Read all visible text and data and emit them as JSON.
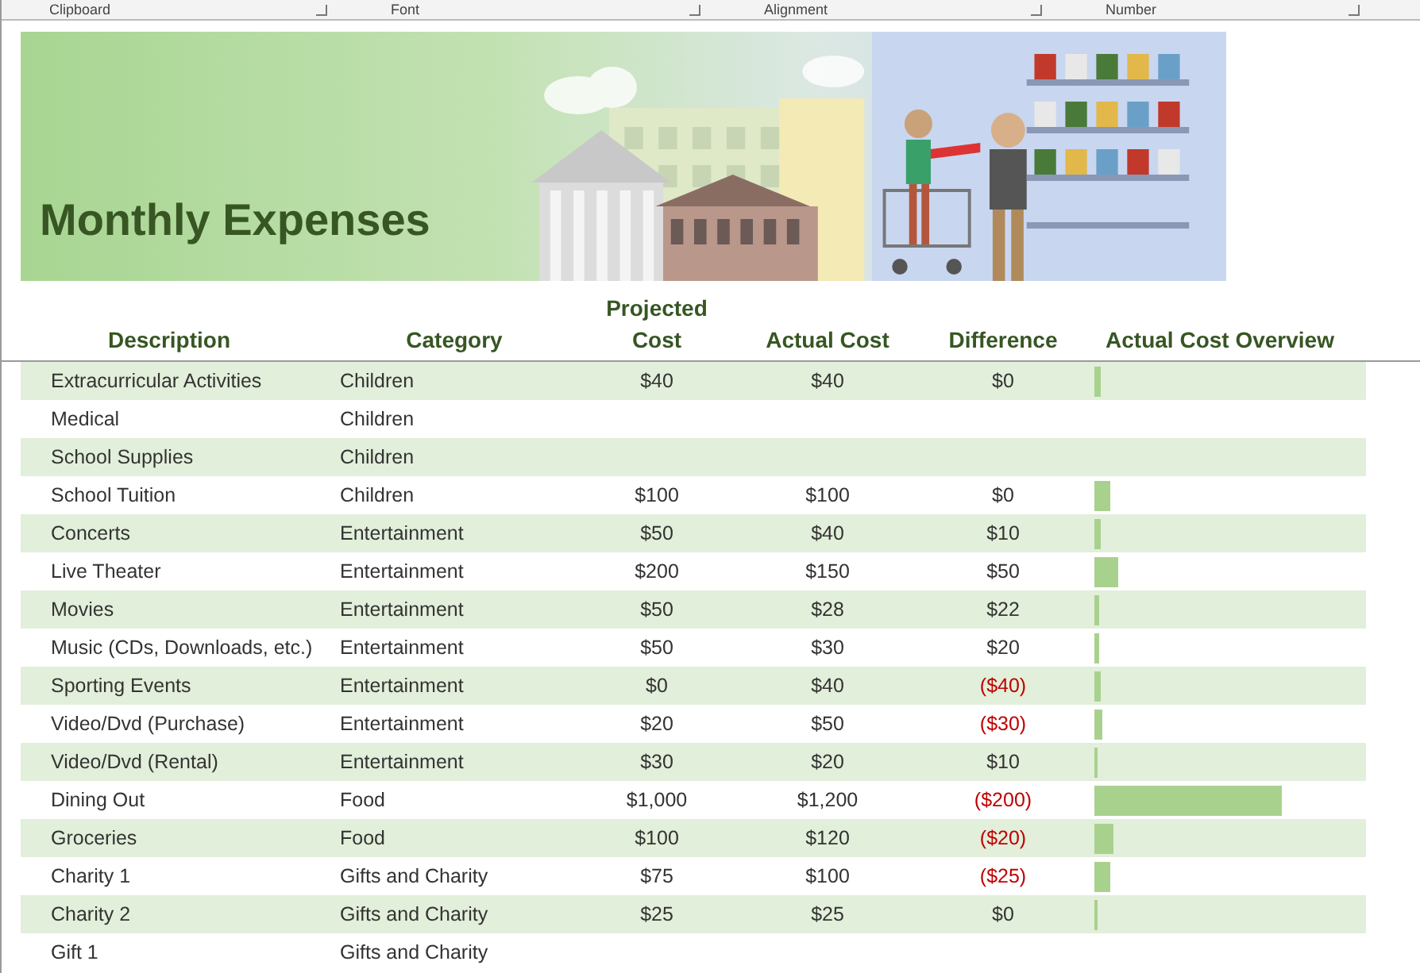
{
  "ribbon": {
    "groups": [
      "Clipboard",
      "Font",
      "Alignment",
      "Number"
    ]
  },
  "banner": {
    "title": "Monthly Expenses"
  },
  "table": {
    "columns": [
      "Description",
      "Category",
      "Projected Cost",
      "Actual Cost",
      "Difference",
      "Actual Cost Overview"
    ],
    "rows": [
      {
        "description": "Extracurricular Activities",
        "category": "Children",
        "projected": "$40",
        "actual": "$40",
        "difference": "$0",
        "negative": false
      },
      {
        "description": "Medical",
        "category": "Children"
      },
      {
        "description": "School Supplies",
        "category": "Children"
      },
      {
        "description": "School Tuition",
        "category": "Children",
        "projected": "$100",
        "actual": "$100",
        "difference": "$0",
        "negative": false
      },
      {
        "description": "Concerts",
        "category": "Entertainment",
        "projected": "$50",
        "actual": "$40",
        "difference": "$10",
        "negative": false
      },
      {
        "description": "Live Theater",
        "category": "Entertainment",
        "projected": "$200",
        "actual": "$150",
        "difference": "$50",
        "negative": false
      },
      {
        "description": "Movies",
        "category": "Entertainment",
        "projected": "$50",
        "actual": "$28",
        "difference": "$22",
        "negative": false
      },
      {
        "description": "Music (CDs, Downloads, etc.)",
        "category": "Entertainment",
        "projected": "$50",
        "actual": "$30",
        "difference": "$20",
        "negative": false
      },
      {
        "description": "Sporting Events",
        "category": "Entertainment",
        "projected": "$0",
        "actual": "$40",
        "difference": "($40)",
        "negative": true
      },
      {
        "description": "Video/Dvd (Purchase)",
        "category": "Entertainment",
        "projected": "$20",
        "actual": "$50",
        "difference": "($30)",
        "negative": true
      },
      {
        "description": "Video/Dvd (Rental)",
        "category": "Entertainment",
        "projected": "$30",
        "actual": "$20",
        "difference": "$10",
        "negative": false
      },
      {
        "description": "Dining Out",
        "category": "Food",
        "projected": "$1,000",
        "actual": "$1,200",
        "difference": "($200)",
        "negative": true
      },
      {
        "description": "Groceries",
        "category": "Food",
        "projected": "$100",
        "actual": "$120",
        "difference": "($20)",
        "negative": true
      },
      {
        "description": "Charity 1",
        "category": "Gifts and Charity",
        "projected": "$75",
        "actual": "$100",
        "difference": "($25)",
        "negative": true
      },
      {
        "description": "Charity 2",
        "category": "Gifts and Charity",
        "projected": "$25",
        "actual": "$25",
        "difference": "$0",
        "negative": false
      },
      {
        "description": "Gift 1",
        "category": "Gifts and Charity"
      }
    ]
  }
}
